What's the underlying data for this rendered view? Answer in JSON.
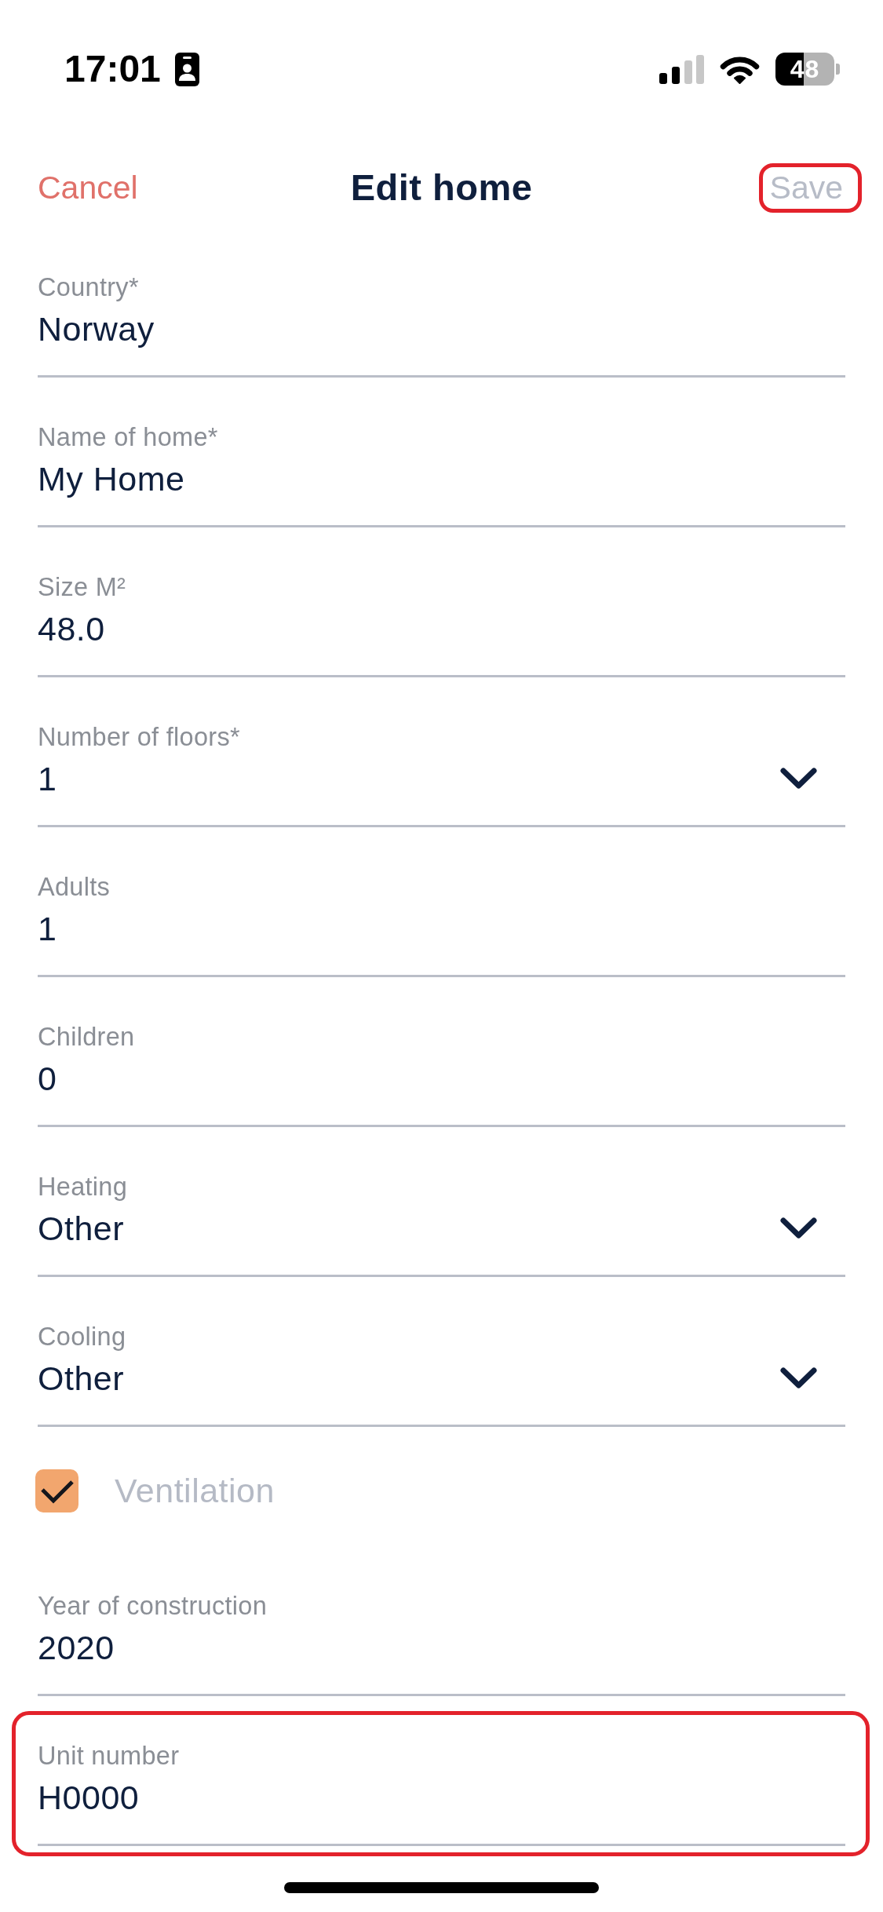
{
  "status_bar": {
    "time": "17:01",
    "battery": "48"
  },
  "header": {
    "cancel": "Cancel",
    "title": "Edit home",
    "save": {
      "label": "Save",
      "disabled": true,
      "highlighted": true
    }
  },
  "fields": [
    {
      "kind": "text",
      "label": "Country*",
      "value": "Norway",
      "highlighted": false
    },
    {
      "kind": "text",
      "label": "Name of home*",
      "value": "My Home",
      "highlighted": false
    },
    {
      "kind": "text",
      "label": "Size M²",
      "value": "48.0",
      "highlighted": false
    },
    {
      "kind": "dropdown",
      "label": "Number of floors*",
      "value": "1",
      "highlighted": false
    },
    {
      "kind": "text",
      "label": "Adults",
      "value": "1",
      "highlighted": false
    },
    {
      "kind": "text",
      "label": "Children",
      "value": "0",
      "highlighted": false
    },
    {
      "kind": "dropdown",
      "label": "Heating",
      "value": "Other",
      "highlighted": false
    },
    {
      "kind": "dropdown",
      "label": "Cooling",
      "value": "Other",
      "highlighted": false
    },
    {
      "kind": "checkbox",
      "label": "Ventilation",
      "checked": true,
      "highlighted": false
    },
    {
      "kind": "text",
      "label": "Year of construction",
      "value": "2020",
      "highlighted": false
    },
    {
      "kind": "text",
      "label": "Unit number",
      "value": "H0000",
      "highlighted": true
    }
  ]
}
